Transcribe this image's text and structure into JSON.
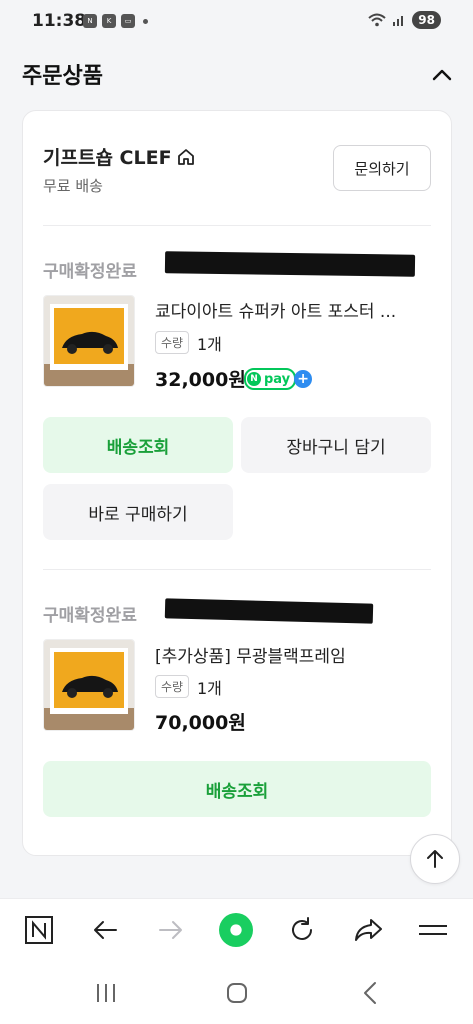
{
  "status_bar": {
    "time": "11:38",
    "battery": "98"
  },
  "section": {
    "title": "주문상품"
  },
  "shop": {
    "name": "기프트숍 CLEF",
    "shipping": "무료 배송",
    "inquiry_label": "문의하기"
  },
  "orders": [
    {
      "status": "구매확정완료",
      "product_name": "쿄다이아트 슈퍼카 아트 포스터 ...",
      "qty_label": "수량",
      "qty_value": "1개",
      "price": "32,000원",
      "npay_label": "pay",
      "buttons": {
        "track": "배송조회",
        "cart": "장바구니 담기",
        "buy_now": "바로 구매하기"
      }
    },
    {
      "status": "구매확정완료",
      "product_name": "[추가상품] 무광블랙프레임",
      "qty_label": "수량",
      "qty_value": "1개",
      "price": "70,000원",
      "buttons": {
        "track": "배송조회"
      }
    }
  ],
  "colors": {
    "accent_green": "#1aa03a",
    "green_bg": "#e6f9ea",
    "npay_green": "#03c75a",
    "nav_green": "#19ce60"
  },
  "icons": [
    "home-icon",
    "chevron-up-icon",
    "arrow-up-icon",
    "naver-n-icon",
    "back-arrow-icon",
    "forward-arrow-icon",
    "green-dot-icon",
    "refresh-icon",
    "share-icon",
    "menu-icon",
    "recent-apps-icon",
    "home-button-icon",
    "system-back-icon"
  ]
}
